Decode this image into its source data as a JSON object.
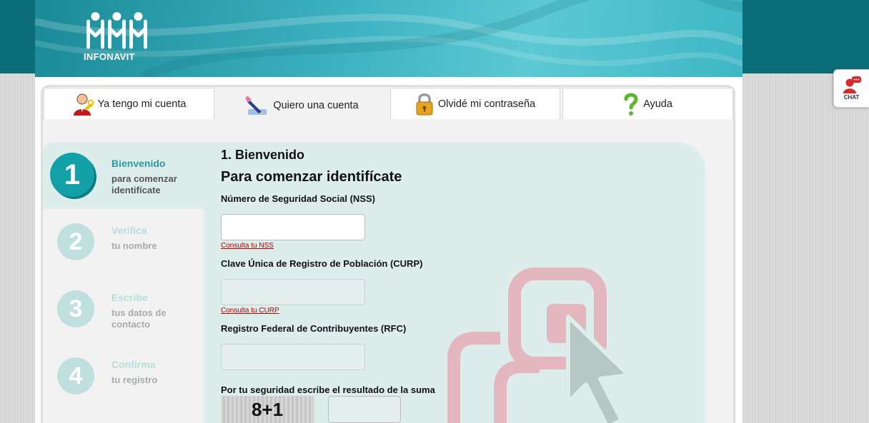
{
  "brand": {
    "name": "INFONAVIT",
    "accent": "#13a0a6",
    "header_color": "#3fb3c2",
    "link_color": "#b00000"
  },
  "tabs": [
    {
      "label": "Ya tengo mi cuenta",
      "icon": "user-key-icon",
      "active": false
    },
    {
      "label": "Quiero una cuenta",
      "icon": "pencil-icon",
      "active": true
    },
    {
      "label": "Olvidé mi contraseña",
      "icon": "padlock-icon",
      "active": false
    },
    {
      "label": "Ayuda",
      "icon": "question-mark-icon",
      "active": false
    }
  ],
  "steps": [
    {
      "number": "1",
      "title": "Bienvenido",
      "subtitle": "para comenzar identifícate",
      "active": true
    },
    {
      "number": "2",
      "title": "Verifica",
      "subtitle": "tu nombre",
      "active": false
    },
    {
      "number": "3",
      "title": "Escribe",
      "subtitle": "tus datos de contacto",
      "active": false
    },
    {
      "number": "4",
      "title": "Confirma",
      "subtitle": "tu registro",
      "active": false
    }
  ],
  "form": {
    "step_heading": "1. Bienvenido",
    "heading": "Para comenzar identifícate",
    "nss": {
      "label": "Número de Seguridad Social (NSS)",
      "value": "",
      "link": "Consulta tu NSS"
    },
    "curp": {
      "label": "Clave Única de Registro de Población (CURP)",
      "value": "",
      "link": "Consulta tu CURP"
    },
    "rfc": {
      "label": "Registro Federal de Contribuyentes (RFC)",
      "value": ""
    },
    "captcha": {
      "label": "Por tu seguridad escribe el resultado de la suma",
      "expression": "8+1",
      "value": ""
    }
  },
  "chat": {
    "label": "CHAT",
    "icon": "chat-agent-icon"
  }
}
